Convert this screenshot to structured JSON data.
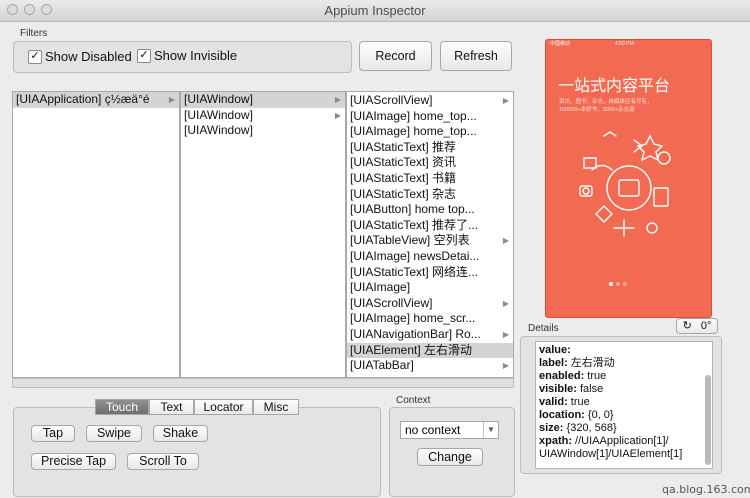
{
  "window": {
    "title": "Appium Inspector"
  },
  "filters": {
    "title": "Filters",
    "show_disabled": "Show Disabled",
    "show_invisible": "Show Invisible",
    "record": "Record",
    "refresh": "Refresh"
  },
  "tree": {
    "column1": [
      {
        "label": "[UIAApplication] ç½æä°é",
        "arrow": "▶",
        "selected": true
      }
    ],
    "column2": [
      {
        "label": "[UIAWindow]",
        "arrow": "▶",
        "selected": true
      },
      {
        "label": "[UIAWindow]",
        "arrow": "▶",
        "selected": false
      },
      {
        "label": "[UIAWindow]",
        "arrow": "",
        "selected": false
      }
    ],
    "column3": [
      {
        "label": "[UIAScrollView]",
        "arrow": "▶",
        "selected": false
      },
      {
        "label": "[UIAImage] home_top...",
        "arrow": "",
        "selected": false
      },
      {
        "label": "[UIAImage] home_top...",
        "arrow": "",
        "selected": false
      },
      {
        "label": "[UIAStaticText] 推荐",
        "arrow": "",
        "selected": false
      },
      {
        "label": "[UIAStaticText] 资讯",
        "arrow": "",
        "selected": false
      },
      {
        "label": "[UIAStaticText] 书籍",
        "arrow": "",
        "selected": false
      },
      {
        "label": "[UIAStaticText] 杂志",
        "arrow": "",
        "selected": false
      },
      {
        "label": "[UIAButton] home top...",
        "arrow": "",
        "selected": false
      },
      {
        "label": "[UIAStaticText] 推荐了...",
        "arrow": "",
        "selected": false
      },
      {
        "label": "[UIATableView] 空列表",
        "arrow": "▶",
        "selected": false
      },
      {
        "label": "[UIAImage] newsDetai...",
        "arrow": "",
        "selected": false
      },
      {
        "label": "[UIAStaticText] 网络连...",
        "arrow": "",
        "selected": false
      },
      {
        "label": "[UIAImage]",
        "arrow": "",
        "selected": false
      },
      {
        "label": "[UIAScrollView]",
        "arrow": "▶",
        "selected": false
      },
      {
        "label": "[UIAImage] home_scr...",
        "arrow": "",
        "selected": false
      },
      {
        "label": "[UIANavigationBar] Ro...",
        "arrow": "▶",
        "selected": false
      },
      {
        "label": "[UIAElement] 左右滑动",
        "arrow": "",
        "selected": true
      },
      {
        "label": "[UIATabBar]",
        "arrow": "▶",
        "selected": false
      }
    ]
  },
  "actions": {
    "tabs": [
      "Touch",
      "Text",
      "Locator",
      "Misc"
    ],
    "active_tab": "Touch",
    "tap": "Tap",
    "swipe": "Swipe",
    "shake": "Shake",
    "precise_tap": "Precise Tap",
    "scroll_to": "Scroll To"
  },
  "context": {
    "title": "Context",
    "selected": "no context",
    "change": "Change"
  },
  "device": {
    "status_left": "中国移动",
    "status_time": "4:50 PM",
    "headline": "一站式内容平台",
    "subline1": "资讯、图书、杂志，自媒体应有尽有，",
    "subline2": "100000+本好书，3000+杂志源",
    "rotation": "0°",
    "background_color": "#f26a51"
  },
  "details": {
    "title": "Details",
    "lines": [
      {
        "key": "value:",
        "val": ""
      },
      {
        "key": "label:",
        "val": " 左右滑动"
      },
      {
        "key": "enabled:",
        "val": " true"
      },
      {
        "key": "visible:",
        "val": " false"
      },
      {
        "key": "valid:",
        "val": " true"
      },
      {
        "key": "location:",
        "val": " {0, 0}"
      },
      {
        "key": "size:",
        "val": " {320, 568}"
      },
      {
        "key": "xpath:",
        "val": " //UIAApplication[1]/"
      },
      {
        "key": "",
        "val": "UIAWindow[1]/UIAElement[1]"
      }
    ]
  },
  "watermark": "qa.blog.163.com"
}
